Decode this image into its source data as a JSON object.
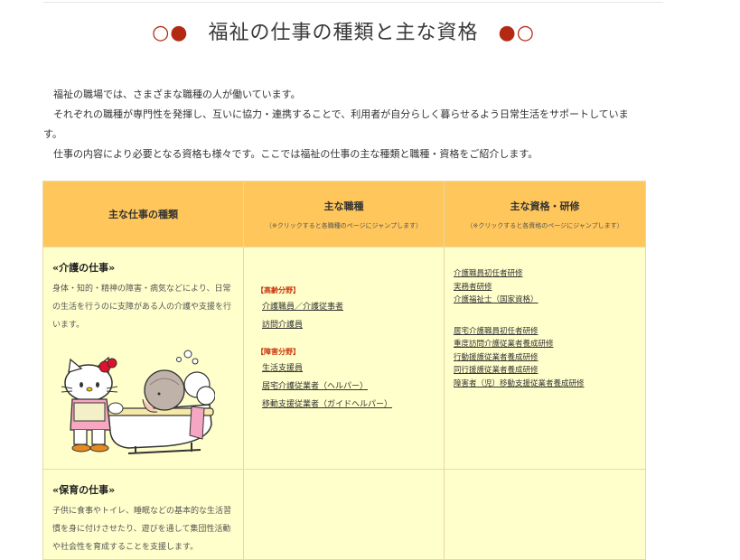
{
  "title": {
    "left_marks": "○●",
    "text": "福祉の仕事の種類と主な資格",
    "right_marks": "●○"
  },
  "intro": [
    "福祉の職場では、さまざまな職種の人が働いています。",
    "それぞれの職種が専門性を発揮し、互いに協力・連携することで、利用者が自分らしく暮らせるよう日常生活をサポートしています。",
    "仕事の内容により必要となる資格も様々です。ここでは福祉の仕事の主な種類と職種・資格をご紹介します。"
  ],
  "table": {
    "headers": [
      {
        "main": "主な仕事の種類",
        "note": ""
      },
      {
        "main": "主な職種",
        "note": "（※クリックすると各職種のページにジャンプします）"
      },
      {
        "main": "主な資格・研修",
        "note": "（※クリックすると各資格のページにジャンプします）"
      }
    ],
    "rows": [
      {
        "title": "«介護の仕事»",
        "desc": "身体・知的・精神の障害・病気などにより、日常の生活を行うのに支障がある人の介護や支援を行います。",
        "fields": [
          {
            "name": "【高齢分野】",
            "jobs": [
              "介護職員／介護従事者",
              "訪問介護員"
            ]
          },
          {
            "name": "【障害分野】",
            "jobs": [
              "生活支援員",
              "居宅介護従業者（ヘルパー）",
              "移動支援従業者（ガイドヘルパー）"
            ]
          }
        ],
        "quals_group1": [
          "介護職員初任者研修",
          "実務者研修",
          "介護福祉士（国家資格）"
        ],
        "quals_group2": [
          "居宅介護職員初任者研修",
          "重度訪問介護従業者養成研修",
          "行動援護従業者養成研修",
          "同行援護従業者養成研修",
          "障害者（児）移動支援従業者養成研修"
        ]
      },
      {
        "title": "«保育の仕事»",
        "desc": "子供に食事やトイレ、睡眠などの基本的な生活習慣を身に付けさせたり、遊びを通して集団性活動や社会性を育成することを支援します。"
      }
    ]
  },
  "colors": {
    "accent_marks": "#b32a14",
    "header_bg": "#ffc65c",
    "cell_bg": "#ffffcc",
    "field_label": "#c8360c"
  }
}
